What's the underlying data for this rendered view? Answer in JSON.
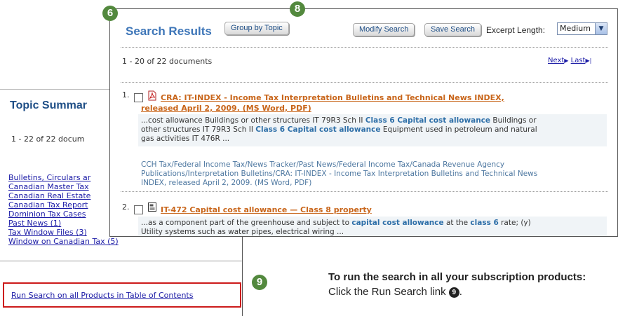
{
  "topic_summary": {
    "title": "Topic Summar",
    "count": "1 - 22 of 22 docum",
    "items": [
      "Bulletins, Circulars ar",
      "Canadian Master Tax",
      "Canadian Real Estate",
      "Canadian Tax Report",
      "Dominion Tax Cases",
      "Past News (1)",
      "Tax Window Files (3)",
      "Window on Canadian Tax (5)"
    ],
    "run_search_link": "Run Search on all Products in Table of Contents"
  },
  "search_results": {
    "title": "Search Results",
    "group_by_topic_label": "Group by Topic",
    "modify_search_label": "Modify Search",
    "save_search_label": "Save Search",
    "excerpt_length_label": "Excerpt Length:",
    "excerpt_length_value": "Medium",
    "range_text": "1 - 20 of 22 documents",
    "pager_next": "Next",
    "pager_last": "Last",
    "results": [
      {
        "number": "1.",
        "icon": "pdf-icon",
        "title_line1": "CRA: IT-INDEX - Income Tax Interpretation Bulletins and Technical News INDEX,",
        "title_line2": "released April 2, 2009. (MS Word, PDF)",
        "excerpt": {
          "a": "...cost allowance Buildings or other structures IT 79R3 Sch II ",
          "b": "Class 6 Capital cost allowance",
          "c": " Buildings or",
          "d": "other structures IT 79R3 Sch II ",
          "e": "Class 6 Capital cost allowance",
          "f": " Equipment used in petroleum and natural",
          "g": "gas activities IT 476R ..."
        },
        "breadcrumb": [
          "CCH Tax/Federal Income Tax/News Tracker/Past News/Federal Income Tax/Canada Revenue Agency",
          "Publications/Interpretation Bulletins/CRA: IT-INDEX - Income Tax Interpretation Bulletins and Technical News",
          "INDEX, released April 2, 2009. (MS Word, PDF)"
        ]
      },
      {
        "number": "2.",
        "icon": "document-icon",
        "title_line1": "IT-472 Capital cost allowance — Class 8 property",
        "excerpt": {
          "a": "...as a component part of the greenhouse and subject to ",
          "b": "capital cost allowance",
          "c": " at the ",
          "d": "class 6",
          "e": " rate; (y)",
          "f": "Utility systems such as water pipes, electrical wiring ..."
        }
      }
    ]
  },
  "badges": {
    "six": "6",
    "eight": "8",
    "nine": "9"
  },
  "instruction": {
    "line1": "To run the search in all your subscription products:",
    "line2": "Click the Run Search link",
    "line2_badge": "9"
  },
  "colors": {
    "badge_green": "#53893e",
    "highlight_border": "#cc1b1b",
    "title_blue": "#3e76b8",
    "result_title_orange": "#c8651a",
    "term_highlight": "#2e6fa8"
  }
}
